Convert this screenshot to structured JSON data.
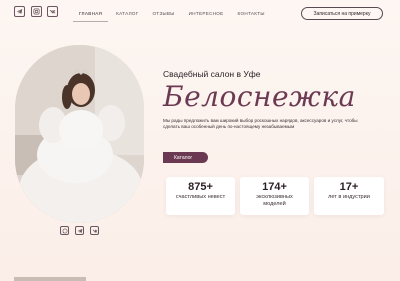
{
  "header": {
    "social": [
      {
        "icon": "telegram-icon"
      },
      {
        "icon": "instagram-icon"
      },
      {
        "icon": "vk-icon"
      }
    ],
    "nav": [
      "ГЛАВНАЯ",
      "КАТАЛОГ",
      "ОТЗЫВЫ",
      "ИНТЕРЕСНОЕ",
      "КОНТАКТЫ"
    ],
    "active_nav": "ГЛАВНАЯ",
    "signup_label": "Записаться на примерку"
  },
  "hero": {
    "subtitle": "Свадебный салон в Уфе",
    "brand": "Белоснежка",
    "description": "Мы рады предложить вам широкий выбор роскошных нарядов, аксессуаров и услуг, чтобы сделать ваш особенный день по-настоящему незабываемым",
    "catalog_label": "Каталог"
  },
  "stats": [
    {
      "num": "875+",
      "label": "счастливых невест"
    },
    {
      "num": "174+",
      "label": "эксклюзивных моделей"
    },
    {
      "num": "17+",
      "label": "лет в индустрии"
    }
  ],
  "bottom_social": [
    {
      "icon": "whatsapp-icon"
    },
    {
      "icon": "telegram-icon"
    },
    {
      "icon": "vk-icon"
    }
  ],
  "colors": {
    "accent": "#6b3a52",
    "background": "#fdf6f2"
  }
}
